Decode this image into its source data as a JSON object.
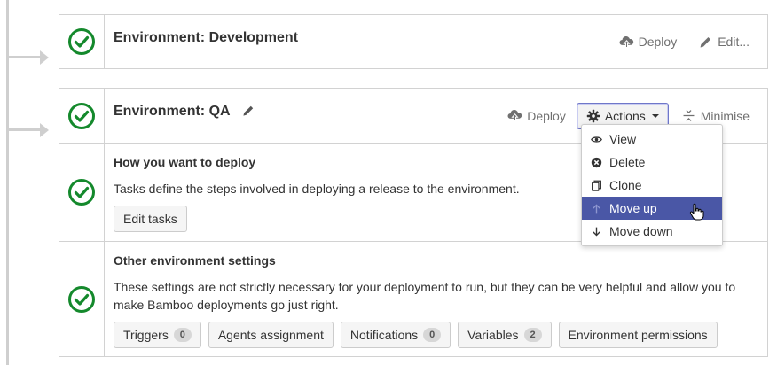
{
  "environments": [
    {
      "title": "Environment: Development",
      "deploy_label": "Deploy",
      "edit_label": "Edit..."
    },
    {
      "title": "Environment: QA",
      "deploy_label": "Deploy",
      "actions_label": "Actions",
      "minimise_label": "Minimise"
    }
  ],
  "sections": {
    "deploy": {
      "title": "How you want to deploy",
      "description": "Tasks define the steps involved in deploying a release to the environment.",
      "edit_tasks_label": "Edit tasks"
    },
    "other": {
      "title": "Other environment settings",
      "description": "These settings are not strictly necessary for your deployment to run, but they can be very helpful and allow you to make Bamboo deployments go just right.",
      "buttons": [
        {
          "label": "Triggers",
          "badge": "0"
        },
        {
          "label": "Agents assignment"
        },
        {
          "label": "Notifications",
          "badge": "0"
        },
        {
          "label": "Variables",
          "badge": "2"
        },
        {
          "label": "Environment permissions"
        }
      ]
    }
  },
  "actions_menu": [
    {
      "label": "View",
      "icon": "eye-icon"
    },
    {
      "label": "Delete",
      "icon": "delete-circle-icon"
    },
    {
      "label": "Clone",
      "icon": "clone-icon"
    },
    {
      "label": "Move up",
      "icon": "arrow-up-icon",
      "highlighted": true
    },
    {
      "label": "Move down",
      "icon": "arrow-down-icon"
    }
  ],
  "colors": {
    "success_green": "#14892c",
    "menu_highlight": "#4a57a6",
    "link_gray": "#707070",
    "border": "#d2d2d2"
  }
}
